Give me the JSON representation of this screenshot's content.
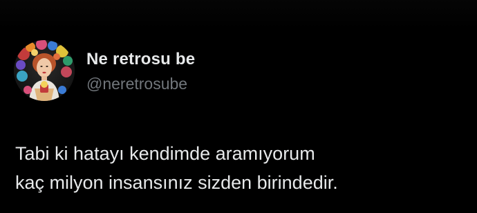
{
  "author": {
    "display_name": "Ne retrosu be",
    "handle": "@neretrosube",
    "avatar_icon": "profile-photo-woman-with-flowers"
  },
  "tweet": {
    "lines": [
      "Tabi ki hatayı kendimde aramıyorum",
      "kaç milyon insansınız sizden birindedir."
    ]
  },
  "colors": {
    "background": "#000000",
    "primary_text": "#e7e9ea",
    "secondary_text": "#71767b"
  }
}
